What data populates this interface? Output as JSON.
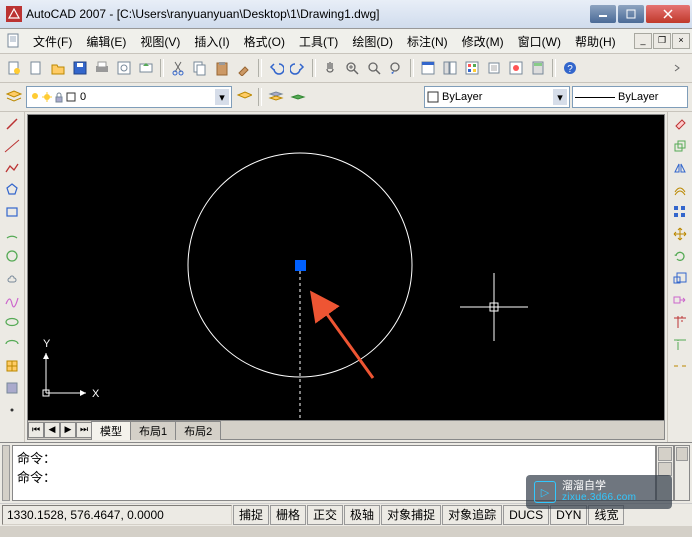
{
  "window": {
    "title": "AutoCAD 2007 - [C:\\Users\\ranyuanyuan\\Desktop\\1\\Drawing1.dwg]"
  },
  "menu": {
    "file": "文件(F)",
    "edit": "编辑(E)",
    "view": "视图(V)",
    "insert": "插入(I)",
    "format": "格式(O)",
    "tools": "工具(T)",
    "draw": "绘图(D)",
    "dim": "标注(N)",
    "modify": "修改(M)",
    "window": "窗口(W)",
    "help": "帮助(H)"
  },
  "layer": {
    "current": "0",
    "bylayer": "ByLayer",
    "bylayer2": "ByLayer"
  },
  "tabs": {
    "model": "模型",
    "layout1": "布局1",
    "layout2": "布局2"
  },
  "cmd": {
    "line1": "命令：",
    "line2": "命令："
  },
  "status": {
    "coords": "1330.1528, 576.4647, 0.0000",
    "snap": "捕捉",
    "grid": "栅格",
    "ortho": "正交",
    "polar": "极轴",
    "osnap": "对象捕捉",
    "otrack": "对象追踪",
    "ducs": "DUCS",
    "dyn": "DYN",
    "lwt": "线宽"
  },
  "ucs": {
    "x": "X",
    "y": "Y"
  },
  "watermark": {
    "brand": "溜溜自学",
    "url": "zixue.3d66.com"
  }
}
